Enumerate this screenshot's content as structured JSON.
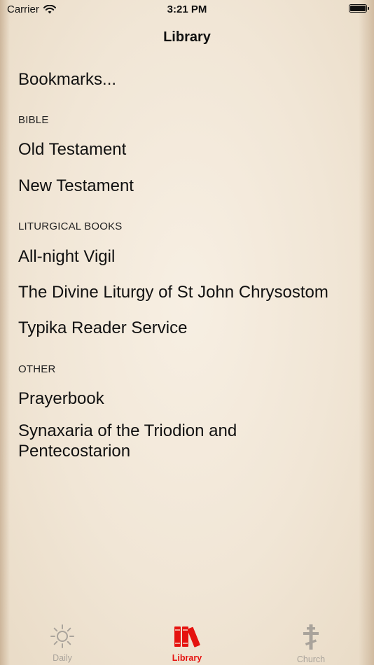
{
  "status_bar": {
    "carrier": "Carrier",
    "time": "3:21 PM"
  },
  "nav": {
    "title": "Library"
  },
  "items": {
    "bookmarks": "Bookmarks...",
    "sections": [
      {
        "header": "BIBLE",
        "items": [
          "Old Testament",
          "New Testament"
        ]
      },
      {
        "header": "LITURGICAL BOOKS",
        "items": [
          "All-night Vigil",
          "The Divine Liturgy of St John Chrysostom",
          "Typika Reader Service"
        ]
      },
      {
        "header": "OTHER",
        "items": [
          "Prayerbook",
          "Synaxaria of the Triodion and Pentecostarion"
        ]
      }
    ]
  },
  "tabs": [
    {
      "label": "Daily",
      "icon": "sun-icon",
      "active": false
    },
    {
      "label": "Library",
      "icon": "books-icon",
      "active": true
    },
    {
      "label": "Church",
      "icon": "orthodox-cross-icon",
      "active": false
    }
  ],
  "colors": {
    "accent": "#e5120f",
    "inactive_tab": "#a9a39b"
  }
}
